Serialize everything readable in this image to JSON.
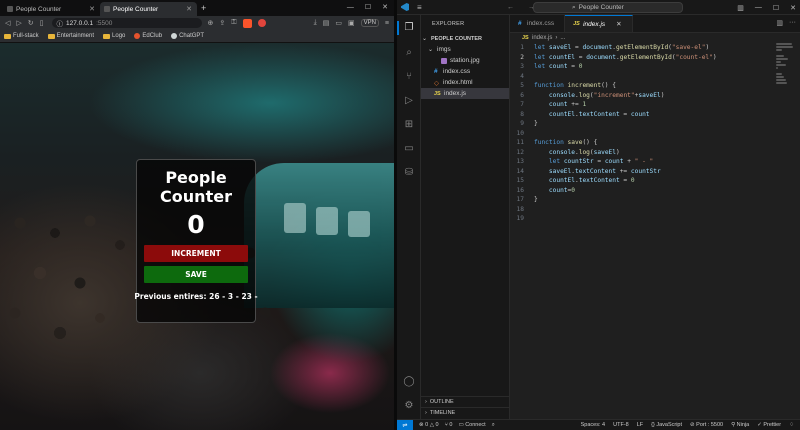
{
  "browser": {
    "tabs": [
      {
        "title": "People Counter"
      },
      {
        "title": "People Counter"
      }
    ],
    "url_host": "127.0.0.1",
    "url_port": ":5500",
    "vpn_label": "VPN",
    "bookmarks": [
      {
        "label": "Full-stack",
        "icon": "folder-icon"
      },
      {
        "label": "Entertainment",
        "icon": "folder-icon"
      },
      {
        "label": "Logo",
        "icon": "folder-icon"
      },
      {
        "label": "EdClub",
        "icon": "edclub-icon",
        "color": "#e5532d"
      },
      {
        "label": "ChatGPT",
        "icon": "chatgpt-icon",
        "color": "#cfd6d6"
      }
    ],
    "brave_badge": "2"
  },
  "app": {
    "title": "People Counter",
    "count": "0",
    "increment_label": "INCREMENT",
    "save_label": "SAVE",
    "entries_text": "Previous entires: 26 - 3 - 23 -",
    "increment_color": "#8c0b0b",
    "save_color": "#0d6a0d"
  },
  "vscode": {
    "search_placeholder": "People Counter",
    "explorer_title": "EXPLORER",
    "project_name": "PEOPLE COUNTER",
    "files": [
      {
        "name": "imgs",
        "type": "folder"
      },
      {
        "name": "station.jpg",
        "type": "image"
      },
      {
        "name": "index.css",
        "type": "css"
      },
      {
        "name": "index.html",
        "type": "html"
      },
      {
        "name": "index.js",
        "type": "js"
      }
    ],
    "outline_label": "OUTLINE",
    "timeline_label": "TIMELINE",
    "tabs": [
      {
        "name": "index.css",
        "active": false
      },
      {
        "name": "index.js",
        "active": true
      }
    ],
    "breadcrumb": [
      "index.js",
      "..."
    ],
    "code_lines": [
      "let saveEl = document.getElementById(\"save-el\")",
      "let countEl = document.getElementById(\"count-el\")",
      "let count = 0",
      "",
      "function increment() {",
      "    console.log(\"increment\"+saveEl)",
      "    count += 1",
      "    countEl.textContent = count",
      "}",
      "",
      "function save() {",
      "    console.log(saveEl)",
      "    let countStr = count + \" - \"",
      "    saveEl.textContent += countStr",
      "    countEl.textContent = 0",
      "    count=0",
      "}",
      "",
      ""
    ],
    "status": {
      "errors": "0",
      "warnings": "0",
      "ports": "0",
      "connect": "Connect",
      "spaces": "Spaces: 4",
      "encoding": "UTF-8",
      "eol": "LF",
      "language": "JavaScript",
      "port": "Port : 5500",
      "ninja": "Ninja",
      "prettier": "Prettier"
    },
    "accent": "#0078d4"
  }
}
